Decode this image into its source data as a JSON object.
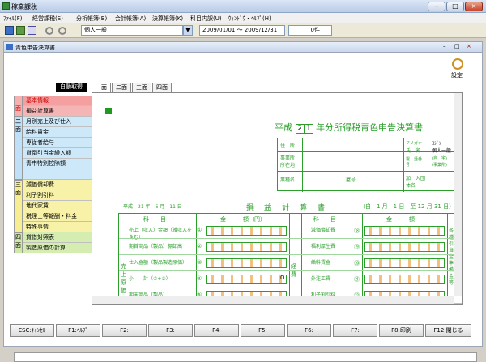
{
  "window": {
    "title": "稼業課税"
  },
  "menubar": [
    "ﾌｧｲﾙ(F)",
    "経営課税(S)",
    "分析帳簿(B)",
    "会計帳簿(A)",
    "決算帳簿(K)",
    "科目内訳(U)",
    "ｳｨﾝﾄﾞｳ・ﾍﾙﾌﾟ(H)"
  ],
  "toolbar": {
    "category": "個人一般",
    "period": "2009/01/01 〜 2009/12/31",
    "count": "0件"
  },
  "inner": {
    "title": "青色申告決算書",
    "settings_label": "設定",
    "auto_get": "自動取得"
  },
  "tabs": [
    "一面",
    "二面",
    "三面",
    "四面"
  ],
  "sidebar": {
    "groups": [
      "一面",
      "二面",
      "三面",
      "四面"
    ],
    "items": [
      "基本情報",
      "損益計算書",
      "月別売上及び仕入",
      "給料賃金",
      "専従者給与",
      "貸倒引当金繰入額",
      "青申特別控除額",
      "減価償却費",
      "利子割引料",
      "地代家賃",
      "税理士等報酬・料金",
      "特殊事情",
      "貸借対照表",
      "製造原価の計算"
    ]
  },
  "form": {
    "heading_parts": [
      "平成",
      "2",
      "1",
      "年分所得税青色申告決算書"
    ],
    "addr_labels": [
      "住　所",
      "事業所所在地",
      "業種名",
      "屋号"
    ],
    "name_labels": [
      "フリガナ",
      "氏　名",
      "電　話番　号",
      "加　入団体名"
    ],
    "furigana": "ｺｼﾞﾝ",
    "name": "個人一般",
    "phone_sub": [
      "(自　宅)",
      "(事業所)"
    ],
    "date_line": "平成　21 年　6 月　11 日",
    "pl_title": "損　益　計　算　書",
    "pl_period": "（自　1 月　1 日　至 12 月 31 日）",
    "col_headers": [
      "科　　目",
      "金　　　額（円）",
      "科　　目",
      "金　　　額"
    ],
    "left_rows": [
      "売上（収入）金額（雑収入を含む）",
      "期首商品（製品）棚卸高",
      "仕入金額（製品製造原価）",
      "小　　計（②+③）",
      "期末商品（製品）"
    ],
    "left_nums": [
      "①",
      "②",
      "③",
      "④",
      "⑤"
    ],
    "right_rows": [
      "減価償却費",
      "福利厚生費",
      "給料賃金",
      "外注工賃",
      "利子割引料"
    ],
    "right_nums": [
      "⑱",
      "⑲",
      "⑳",
      "㉑",
      "㉒"
    ],
    "vert": [
      "売上原価",
      "経費",
      "各種引当金・準備金等",
      "専従者"
    ],
    "zero": "0"
  },
  "fkeys": [
    "ESC:ｷｬﾝｾﾙ",
    "F1:ﾍﾙﾌﾟ",
    "F2:",
    "F3:",
    "F4:",
    "F5:",
    "F6:",
    "F7:",
    "F8:印刷",
    "F12:閉じる"
  ]
}
